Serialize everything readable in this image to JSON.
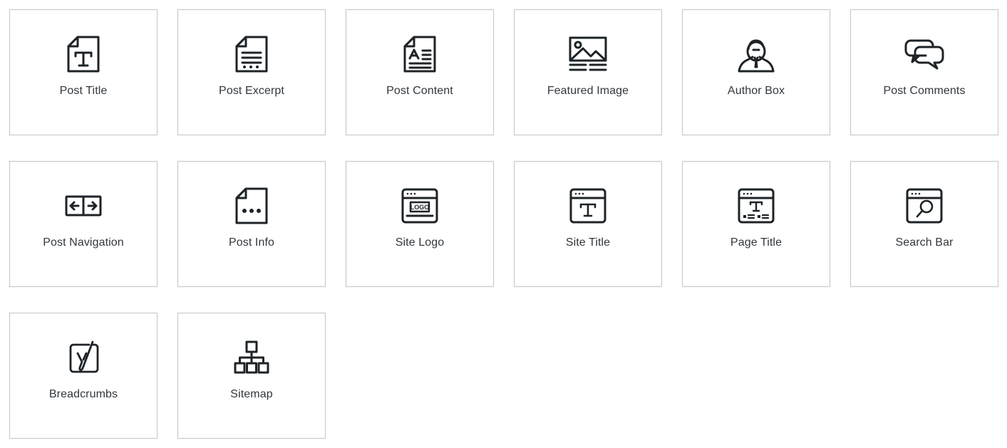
{
  "panel": {
    "title": "",
    "accent_color": "#32373c",
    "card_border_color": "#c3c4c7",
    "icon_color": "#1d2327",
    "background_color": "#ffffff"
  },
  "widgets": [
    {
      "label": "Post Title",
      "icon": "document-title-icon"
    },
    {
      "label": "Post Excerpt",
      "icon": "document-excerpt-icon"
    },
    {
      "label": "Post Content",
      "icon": "document-content-icon"
    },
    {
      "label": "Featured Image",
      "icon": "featured-image-icon"
    },
    {
      "label": "Author Box",
      "icon": "author-person-icon"
    },
    {
      "label": "Post Comments",
      "icon": "comment-bubbles-icon"
    },
    {
      "label": "Post Navigation",
      "icon": "prev-next-arrows-icon"
    },
    {
      "label": "Post Info",
      "icon": "document-dots-icon"
    },
    {
      "label": "Site Logo",
      "icon": "browser-logo-icon"
    },
    {
      "label": "Site Title",
      "icon": "browser-title-icon"
    },
    {
      "label": "Page Title",
      "icon": "browser-page-title-icon"
    },
    {
      "label": "Search Bar",
      "icon": "browser-search-icon"
    },
    {
      "label": "Breadcrumbs",
      "icon": "yoast-breadcrumbs-icon"
    },
    {
      "label": "Sitemap",
      "icon": "sitemap-tree-icon"
    }
  ]
}
